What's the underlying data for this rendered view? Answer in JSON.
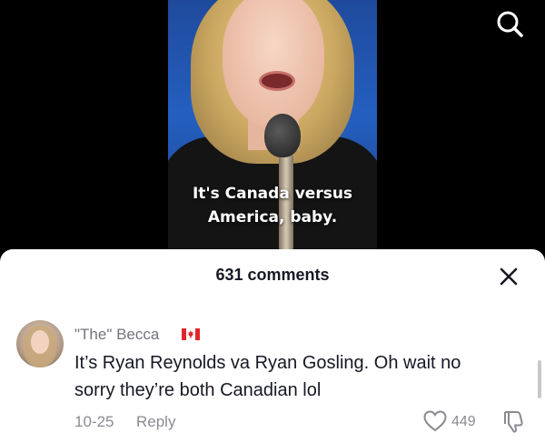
{
  "video": {
    "caption_line1": "It's Canada versus",
    "caption_line2": "America, baby."
  },
  "icons": {
    "search": "search-icon",
    "close": "close-icon",
    "heart": "heart-icon",
    "dislike": "thumbs-down-icon",
    "flag": "canada-flag-icon"
  },
  "comments_sheet": {
    "title": "631 comments",
    "comment": {
      "username": "\"The\" Becca",
      "text_line1": "It’s Ryan Reynolds va Ryan Gosling. Oh wait no",
      "text_line2": "sorry they’re both Canadian lol",
      "date": "10-25",
      "reply_label": "Reply",
      "likes": "449"
    }
  },
  "colors": {
    "sheet_bg": "#ffffff",
    "muted_text": "#8a8b91",
    "primary_text": "#161823",
    "flag_red": "#e0262b"
  }
}
